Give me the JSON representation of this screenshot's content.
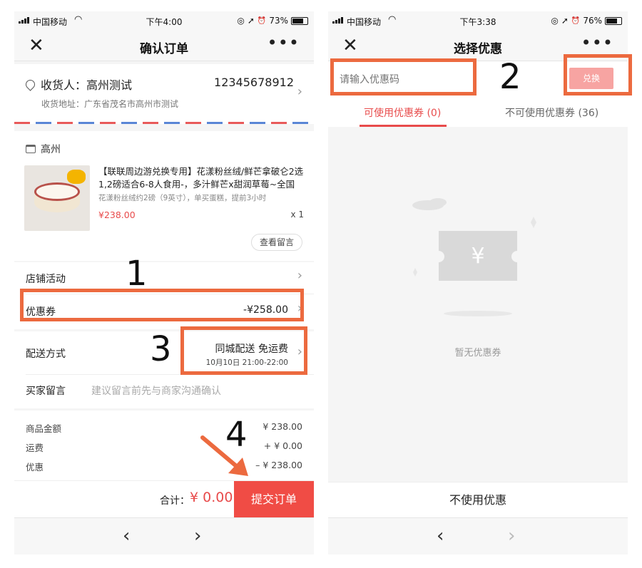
{
  "left_phone": {
    "status": {
      "carrier": "中国移动",
      "time": "下午4:00",
      "battery": "73%",
      "battery_level": 0.73
    },
    "nav": {
      "title": "确认订单"
    },
    "address": {
      "receiver": "收货人：高州测试",
      "phone": "12345678912",
      "detail": "收货地址：广东省茂名市高州市测试"
    },
    "store": {
      "name": "高州"
    },
    "goods": {
      "title": "【联联周边游兑换专用】花漾粉丝绒/鲜芒拿破仑2选1,2磅适合6-8人食用-，多汁鲜芒x甜润草莓~全国",
      "spec": "花漾粉丝绒约2磅（9英寸），单买蛋糕，提前3小时",
      "price": "¥238.00",
      "qty": "x 1",
      "message_button": "查看留言"
    },
    "rows": {
      "store_activity": "店铺活动",
      "coupon_label": "优惠券",
      "coupon_value": "-¥258.00",
      "delivery_label": "配送方式",
      "delivery_value": "同城配送 免运费",
      "delivery_time": "10月10日 21:00-22:00",
      "buyer_note_label": "买家留言",
      "buyer_note_placeholder": "建议留言前先与商家沟通确认"
    },
    "summary": [
      {
        "label": "商品金额",
        "value": "¥ 238.00"
      },
      {
        "label": "运费",
        "value": "+ ¥ 0.00"
      },
      {
        "label": "优惠",
        "value": "– ¥ 238.00"
      }
    ],
    "bottom": {
      "total_label": "合计：",
      "total_value": "¥ 0.00",
      "submit": "提交订单"
    }
  },
  "right_phone": {
    "status": {
      "carrier": "中国移动",
      "time": "下午3:38",
      "battery": "76%",
      "battery_level": 0.76
    },
    "nav": {
      "title": "选择优惠"
    },
    "code_input": {
      "placeholder": "请输入优惠码"
    },
    "redeem_button": "兑换",
    "tabs": [
      {
        "label": "可使用优惠券 (0)"
      },
      {
        "label": "不可使用优惠券 (36)"
      }
    ],
    "empty": {
      "icon_symbol": "¥",
      "text": "暂无优惠券"
    },
    "no_use_button": "不使用优惠"
  },
  "annotations": {
    "callout_1": "1",
    "callout_2": "2",
    "callout_3": "3",
    "callout_4": "4",
    "highlight_color": "#ec6a3f"
  },
  "glyphs": {
    "close": "✕",
    "more": "•••",
    "chevron": "›",
    "back": "‹",
    "forward": "›",
    "wifi": "◠",
    "location": "➚",
    "alarm": "⏰",
    "lock": "◎"
  },
  "colors": {
    "accent": "#e84b4b",
    "submit_bg": "#f04c45",
    "redeem_bg": "#f7a4a2"
  }
}
